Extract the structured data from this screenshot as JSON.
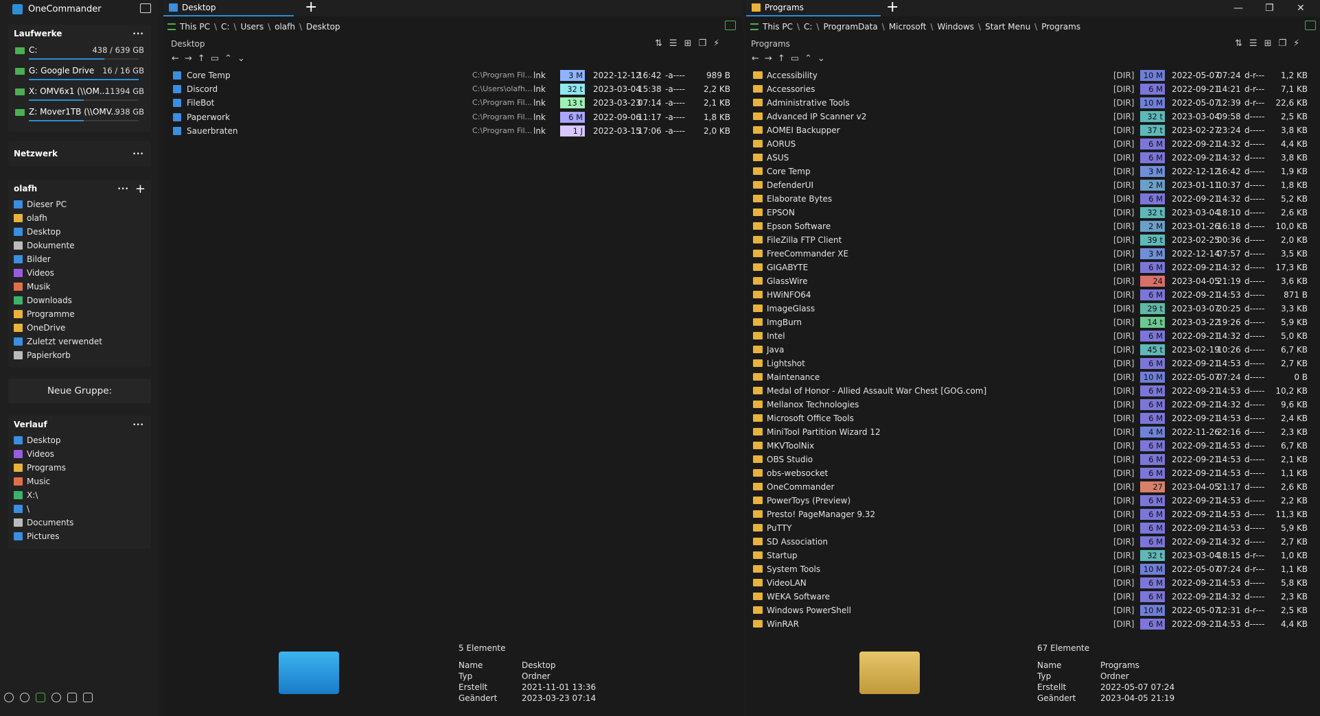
{
  "app": {
    "title": "OneCommander"
  },
  "sidebar": {
    "drives_title": "Laufwerke",
    "drives": [
      {
        "name": "C:",
        "size": "438 / 639 GB",
        "fill": 0.69
      },
      {
        "name": "G:  Google Drive",
        "size": "16 / 16 GB",
        "fill": 1.0
      },
      {
        "name": "X:  OMV6x1 (\\\\OM...",
        "size": "11394 GB",
        "fill": 0.5
      },
      {
        "name": "Z:  Mover1TB (\\\\OMV...",
        "size": "938 GB",
        "fill": 0.5
      }
    ],
    "network_title": "Netzwerk",
    "user_title": "olafh",
    "user_items": [
      "Dieser PC",
      "olafh",
      "Desktop",
      "Dokumente",
      "Bilder",
      "Videos",
      "Musik",
      "Downloads",
      "Programme",
      "OneDrive",
      "Zuletzt verwendet",
      "Papierkorb"
    ],
    "new_group": "Neue Gruppe:",
    "history_title": "Verlauf",
    "history_items": [
      "Desktop",
      "Videos",
      "Programs",
      "Music",
      "X:\\",
      "\\",
      "Documents",
      "Pictures"
    ],
    "dots": "···",
    "plus": "+"
  },
  "left_pane": {
    "tab": "Desktop",
    "path": [
      "This PC",
      "C:",
      "Users",
      "olafh",
      "Desktop"
    ],
    "label": "Desktop",
    "files": [
      {
        "name": "Core Temp",
        "target": "C:\\Program Fil...",
        "ext": "lnk",
        "age": "3 M",
        "age_color": "#8fb4ff",
        "date": "2022-12-12",
        "time": "16:42",
        "attr": "-a----",
        "size": "989 B"
      },
      {
        "name": "Discord",
        "target": "C:\\Users\\olafh...",
        "ext": "lnk",
        "age": "32 t",
        "age_color": "#8fe8f0",
        "date": "2023-03-04",
        "time": "15:38",
        "attr": "-a----",
        "size": "2,2 KB"
      },
      {
        "name": "FileBot",
        "target": "C:\\Program Fil...",
        "ext": "lnk",
        "age": "13 t",
        "age_color": "#9ff0b4",
        "date": "2023-03-23",
        "time": "07:14",
        "attr": "-a----",
        "size": "2,1 KB"
      },
      {
        "name": "Paperwork",
        "target": "C:\\Program Fil...",
        "ext": "lnk",
        "age": "6 M",
        "age_color": "#a9a6ff",
        "date": "2022-09-06",
        "time": "11:17",
        "attr": "-a----",
        "size": "1,8 KB"
      },
      {
        "name": "Sauerbraten",
        "target": "C:\\Program Fil...",
        "ext": "lnk",
        "age": "1 J",
        "age_color": "#d8c8ff",
        "date": "2022-03-15",
        "time": "17:06",
        "attr": "-a----",
        "size": "2,0 KB"
      }
    ],
    "count": "5 Elemente",
    "details": [
      {
        "label": "Name",
        "value": "Desktop"
      },
      {
        "label": "Typ",
        "value": "Ordner"
      },
      {
        "label": "Erstellt",
        "value": "2021-11-01  13:36"
      },
      {
        "label": "Geändert",
        "value": "2023-03-23  07:14"
      }
    ]
  },
  "right_pane": {
    "tab": "Programs",
    "path": [
      "This PC",
      "C:",
      "ProgramData",
      "Microsoft",
      "Windows",
      "Start Menu",
      "Programs"
    ],
    "label": "Programs",
    "folders": [
      {
        "name": "Accessibility",
        "age": "10 M",
        "c": "#6f7fd8",
        "date": "2022-05-07",
        "time": "07:24",
        "attr": "d-r---",
        "size": "1,2 KB"
      },
      {
        "name": "Accessories",
        "age": "6 M",
        "c": "#7b76d8",
        "date": "2022-09-21",
        "time": "14:21",
        "attr": "d-r---",
        "size": "7,1 KB"
      },
      {
        "name": "Administrative Tools",
        "age": "10 M",
        "c": "#6f7fd8",
        "date": "2022-05-07",
        "time": "12:39",
        "attr": "d-r---",
        "size": "22,6 KB"
      },
      {
        "name": "Advanced IP Scanner v2",
        "age": "32 t",
        "c": "#5fb8b8",
        "date": "2023-03-04",
        "time": "09:58",
        "attr": "d-----",
        "size": "2,5 KB"
      },
      {
        "name": "AOMEI Backupper",
        "age": "37 t",
        "c": "#5fb8b8",
        "date": "2023-02-27",
        "time": "23:24",
        "attr": "d-----",
        "size": "3,8 KB"
      },
      {
        "name": "AORUS",
        "age": "6 M",
        "c": "#7b76d8",
        "date": "2022-09-21",
        "time": "14:32",
        "attr": "d-----",
        "size": "4,4 KB"
      },
      {
        "name": "ASUS",
        "age": "6 M",
        "c": "#7b76d8",
        "date": "2022-09-21",
        "time": "14:32",
        "attr": "d-----",
        "size": "3,8 KB"
      },
      {
        "name": "Core Temp",
        "age": "3 M",
        "c": "#6f8fd8",
        "date": "2022-12-12",
        "time": "16:42",
        "attr": "d-----",
        "size": "1,9 KB"
      },
      {
        "name": "DefenderUI",
        "age": "2 M",
        "c": "#6aa0c8",
        "date": "2023-01-11",
        "time": "10:37",
        "attr": "d-----",
        "size": "1,8 KB"
      },
      {
        "name": "Elaborate Bytes",
        "age": "6 M",
        "c": "#7b76d8",
        "date": "2022-09-21",
        "time": "14:32",
        "attr": "d-----",
        "size": "5,2 KB"
      },
      {
        "name": "EPSON",
        "age": "32 t",
        "c": "#5fb8b8",
        "date": "2023-03-04",
        "time": "18:10",
        "attr": "d-----",
        "size": "2,6 KB"
      },
      {
        "name": "Epson Software",
        "age": "2 M",
        "c": "#6aa0c8",
        "date": "2023-01-26",
        "time": "16:18",
        "attr": "d-----",
        "size": "10,0 KB"
      },
      {
        "name": "FileZilla FTP Client",
        "age": "39 t",
        "c": "#5fb8b8",
        "date": "2023-02-25",
        "time": "00:36",
        "attr": "d-----",
        "size": "2,0 KB"
      },
      {
        "name": "FreeCommander XE",
        "age": "3 M",
        "c": "#6f8fd8",
        "date": "2022-12-14",
        "time": "07:57",
        "attr": "d-----",
        "size": "3,5 KB"
      },
      {
        "name": "GIGABYTE",
        "age": "6 M",
        "c": "#7b76d8",
        "date": "2022-09-21",
        "time": "14:32",
        "attr": "d-----",
        "size": "17,3 KB"
      },
      {
        "name": "GlassWire",
        "age": "24",
        "c": "#d8706a",
        "date": "2023-04-05",
        "time": "21:19",
        "attr": "d-----",
        "size": "3,6 KB"
      },
      {
        "name": "HWiNFO64",
        "age": "6 M",
        "c": "#7b76d8",
        "date": "2022-09-21",
        "time": "14:53",
        "attr": "d-----",
        "size": "871 B"
      },
      {
        "name": "ImageGlass",
        "age": "29 t",
        "c": "#5fb8a8",
        "date": "2023-03-07",
        "time": "20:25",
        "attr": "d-----",
        "size": "3,3 KB"
      },
      {
        "name": "ImgBurn",
        "age": "14 t",
        "c": "#6ac890",
        "date": "2023-03-22",
        "time": "19:26",
        "attr": "d-----",
        "size": "5,9 KB"
      },
      {
        "name": "Intel",
        "age": "6 M",
        "c": "#7b76d8",
        "date": "2022-09-21",
        "time": "14:32",
        "attr": "d-----",
        "size": "5,0 KB"
      },
      {
        "name": "Java",
        "age": "45 t",
        "c": "#5fb8b8",
        "date": "2023-02-19",
        "time": "10:26",
        "attr": "d-----",
        "size": "6,7 KB"
      },
      {
        "name": "Lightshot",
        "age": "6 M",
        "c": "#7b76d8",
        "date": "2022-09-21",
        "time": "14:53",
        "attr": "d-----",
        "size": "2,7 KB"
      },
      {
        "name": "Maintenance",
        "age": "10 M",
        "c": "#6f7fd8",
        "date": "2022-05-07",
        "time": "07:24",
        "attr": "d-----",
        "size": "0 B"
      },
      {
        "name": "Medal of Honor - Allied Assault War Chest [GOG.com]",
        "age": "6 M",
        "c": "#7b76d8",
        "date": "2022-09-21",
        "time": "14:53",
        "attr": "d-----",
        "size": "10,2 KB"
      },
      {
        "name": "Mellanox Technologies",
        "age": "6 M",
        "c": "#7b76d8",
        "date": "2022-09-21",
        "time": "14:32",
        "attr": "d-----",
        "size": "9,6 KB"
      },
      {
        "name": "Microsoft Office Tools",
        "age": "6 M",
        "c": "#7b76d8",
        "date": "2022-09-21",
        "time": "14:53",
        "attr": "d-----",
        "size": "2,4 KB"
      },
      {
        "name": "MiniTool Partition Wizard 12",
        "age": "4 M",
        "c": "#6f84d8",
        "date": "2022-11-26",
        "time": "22:16",
        "attr": "d-----",
        "size": "2,3 KB"
      },
      {
        "name": "MKVToolNix",
        "age": "6 M",
        "c": "#7b76d8",
        "date": "2022-09-21",
        "time": "14:53",
        "attr": "d-----",
        "size": "6,7 KB"
      },
      {
        "name": "OBS Studio",
        "age": "6 M",
        "c": "#7b76d8",
        "date": "2022-09-21",
        "time": "14:53",
        "attr": "d-----",
        "size": "2,1 KB"
      },
      {
        "name": "obs-websocket",
        "age": "6 M",
        "c": "#7b76d8",
        "date": "2022-09-21",
        "time": "14:53",
        "attr": "d-----",
        "size": "1,1 KB"
      },
      {
        "name": "OneCommander",
        "age": "27",
        "c": "#d8806a",
        "date": "2023-04-05",
        "time": "21:17",
        "attr": "d-----",
        "size": "2,6 KB"
      },
      {
        "name": "PowerToys (Preview)",
        "age": "6 M",
        "c": "#7b76d8",
        "date": "2022-09-21",
        "time": "14:53",
        "attr": "d-----",
        "size": "2,2 KB"
      },
      {
        "name": "Presto! PageManager 9.32",
        "age": "6 M",
        "c": "#7b76d8",
        "date": "2022-09-21",
        "time": "14:53",
        "attr": "d-----",
        "size": "11,3 KB"
      },
      {
        "name": "PuTTY",
        "age": "6 M",
        "c": "#7b76d8",
        "date": "2022-09-21",
        "time": "14:53",
        "attr": "d-----",
        "size": "5,9 KB"
      },
      {
        "name": "SD Association",
        "age": "6 M",
        "c": "#7b76d8",
        "date": "2022-09-21",
        "time": "14:32",
        "attr": "d-----",
        "size": "2,7 KB"
      },
      {
        "name": "Startup",
        "age": "32 t",
        "c": "#5fb8b8",
        "date": "2023-03-04",
        "time": "18:15",
        "attr": "d-r---",
        "size": "1,0 KB"
      },
      {
        "name": "System Tools",
        "age": "10 M",
        "c": "#6f7fd8",
        "date": "2022-05-07",
        "time": "07:24",
        "attr": "d-r---",
        "size": "1,1 KB"
      },
      {
        "name": "VideoLAN",
        "age": "6 M",
        "c": "#7b76d8",
        "date": "2022-09-21",
        "time": "14:53",
        "attr": "d-----",
        "size": "5,8 KB"
      },
      {
        "name": "WEKA Software",
        "age": "6 M",
        "c": "#7b76d8",
        "date": "2022-09-21",
        "time": "14:32",
        "attr": "d-----",
        "size": "2,3 KB"
      },
      {
        "name": "Windows PowerShell",
        "age": "10 M",
        "c": "#6f7fd8",
        "date": "2022-05-07",
        "time": "12:31",
        "attr": "d-r---",
        "size": "2,5 KB"
      },
      {
        "name": "WinRAR",
        "age": "6 M",
        "c": "#7b76d8",
        "date": "2022-09-21",
        "time": "14:53",
        "attr": "d-----",
        "size": "4,4 KB"
      }
    ],
    "dir_label": "[DIR]",
    "count": "67 Elemente",
    "details": [
      {
        "label": "Name",
        "value": "Programs"
      },
      {
        "label": "Typ",
        "value": "Ordner"
      },
      {
        "label": "Erstellt",
        "value": "2022-05-07  07:24"
      },
      {
        "label": "Geändert",
        "value": "2023-04-05  21:19"
      }
    ]
  },
  "window": {
    "minimize": "—",
    "maximize": "❐",
    "close": "✕"
  }
}
